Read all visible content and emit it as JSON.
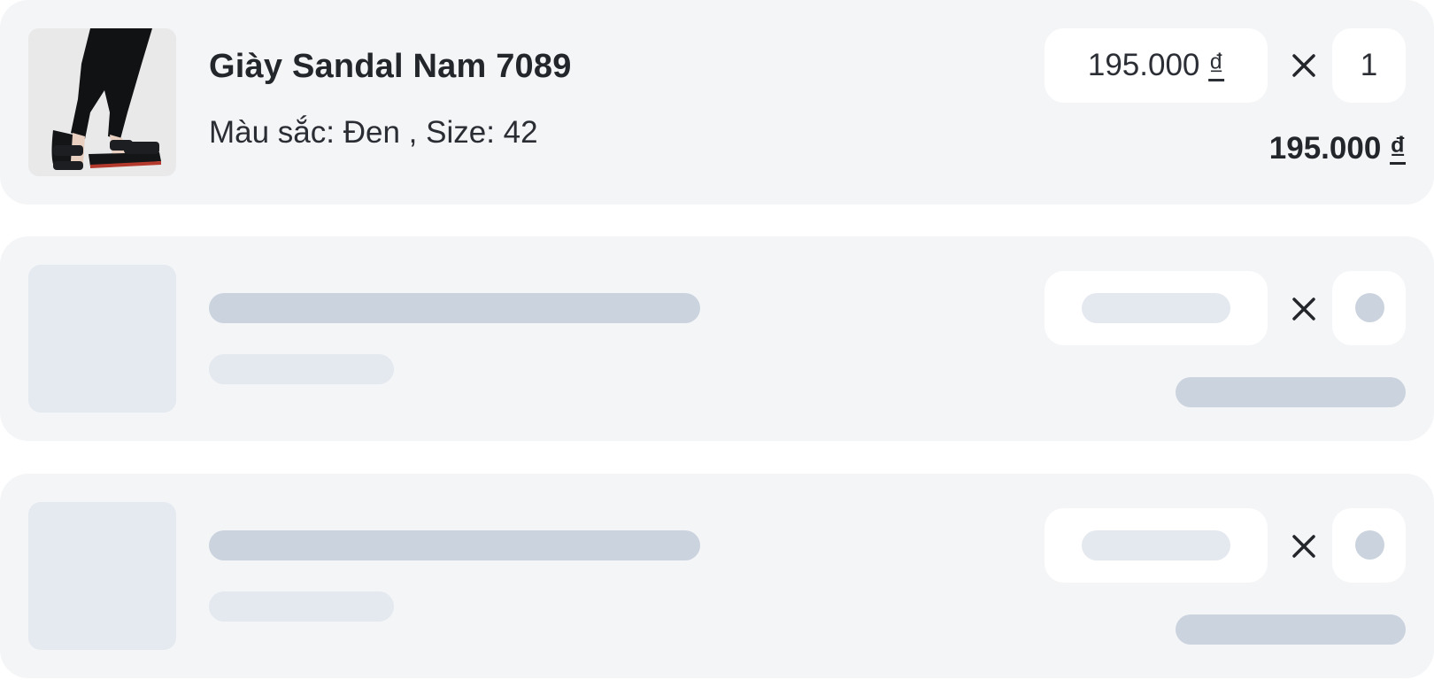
{
  "cart": {
    "item": {
      "name": "Giày Sandal Nam 7089",
      "variant": "Màu sắc: Đen , Size: 42",
      "unit_price": "195.000",
      "quantity": "1",
      "total": "195.000",
      "currency": "₫"
    },
    "skeleton_rows": 2
  },
  "colors": {
    "card_bg": "#f4f5f7",
    "skeleton_dark": "#cbd3de",
    "skeleton_light": "#e4e8ef",
    "text": "#23262b"
  },
  "icons": {
    "multiply": "times-icon",
    "product": "sandal-product-image"
  }
}
